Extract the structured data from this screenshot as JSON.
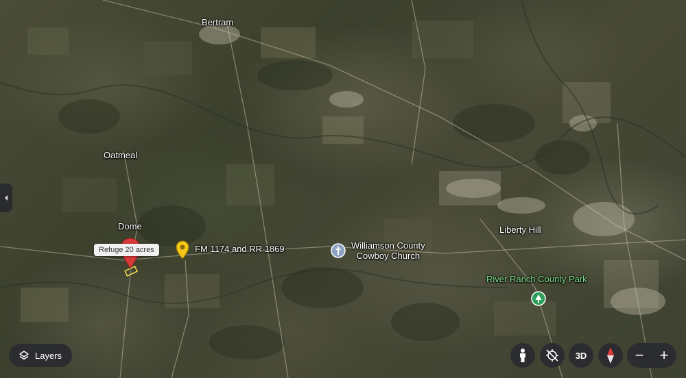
{
  "map": {
    "places": {
      "bertram": "Bertram",
      "oatmeal": "Oatmeal",
      "dome": "Dome",
      "liberty_hill": "Liberty Hill"
    },
    "pois": {
      "fm_road": "FM 1174 and RR 1869",
      "church_line1": "Williamson County",
      "church_line2": "Cowboy Church",
      "park": "River Ranch County Park"
    },
    "selected_marker": {
      "tooltip": "Refuge 20 acres"
    },
    "icons": {
      "selected_pin": "red-pin-icon",
      "road_pin": "yellow-pin-icon",
      "church": "church-icon",
      "park": "park-tree-icon"
    },
    "colors": {
      "selected_pin": "#d93a3a",
      "road_pin": "#f5c518",
      "park_label": "#7fe08a",
      "park_icon": "#2e9e5b",
      "church_icon": "#8aa3c2",
      "control_bg": "#2b2c2f",
      "compass_needle": "#e03a3a"
    }
  },
  "controls": {
    "layers_label": "Layers",
    "threed_label": "3D",
    "zoom_out": "−",
    "zoom_in": "+"
  }
}
